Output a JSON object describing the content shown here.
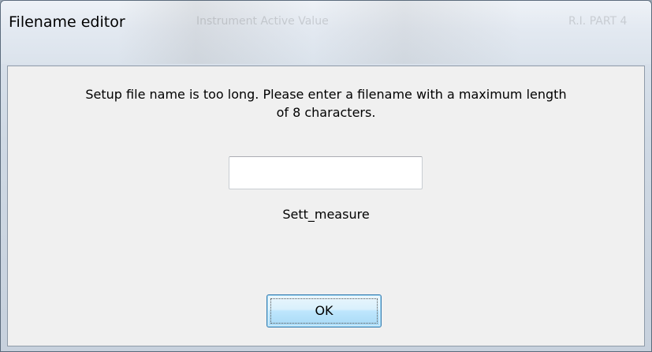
{
  "window": {
    "title": "Filename editor"
  },
  "background_ghost": {
    "text_left": "Instrument  Active  Value",
    "text_right": "R.I. PART 4"
  },
  "dialog": {
    "message_line1": "Setup file name is too long. Please enter a filename with a maximum length",
    "message_line2": "of 8 characters.",
    "input_value": "",
    "current_filename": "Sett_measure",
    "ok_label": "OK"
  },
  "colors": {
    "dialog_bg": "#f0f0f0",
    "button_border": "#3c7fb1",
    "button_fill": "#bee6fd"
  }
}
